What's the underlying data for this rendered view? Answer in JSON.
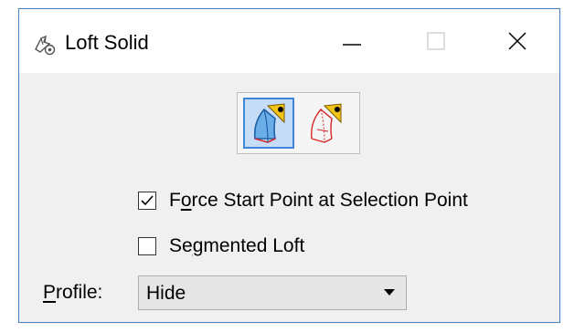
{
  "window": {
    "title": "Loft Solid",
    "controls": {
      "minimize": "minimize",
      "maximize": "maximize",
      "close": "close"
    }
  },
  "mode_buttons": [
    {
      "icon": "loft-solid-smooth-icon",
      "selected": true
    },
    {
      "icon": "loft-solid-outline-icon",
      "selected": false
    }
  ],
  "options": {
    "force_start": {
      "label_prefix": "F",
      "label_underlined": "o",
      "label_suffix": "rce Start Point at Selection Point",
      "checked": true
    },
    "segmented": {
      "label_prefix": "Se",
      "label_underlined": "g",
      "label_suffix": "mented Loft",
      "checked": false
    }
  },
  "profile": {
    "label_underlined": "P",
    "label_suffix": "rofile:",
    "value": "Hide"
  },
  "colors": {
    "accent": "#3f86d9",
    "window_border": "#4a84c8",
    "dialog_background": "#f0f0f0"
  }
}
